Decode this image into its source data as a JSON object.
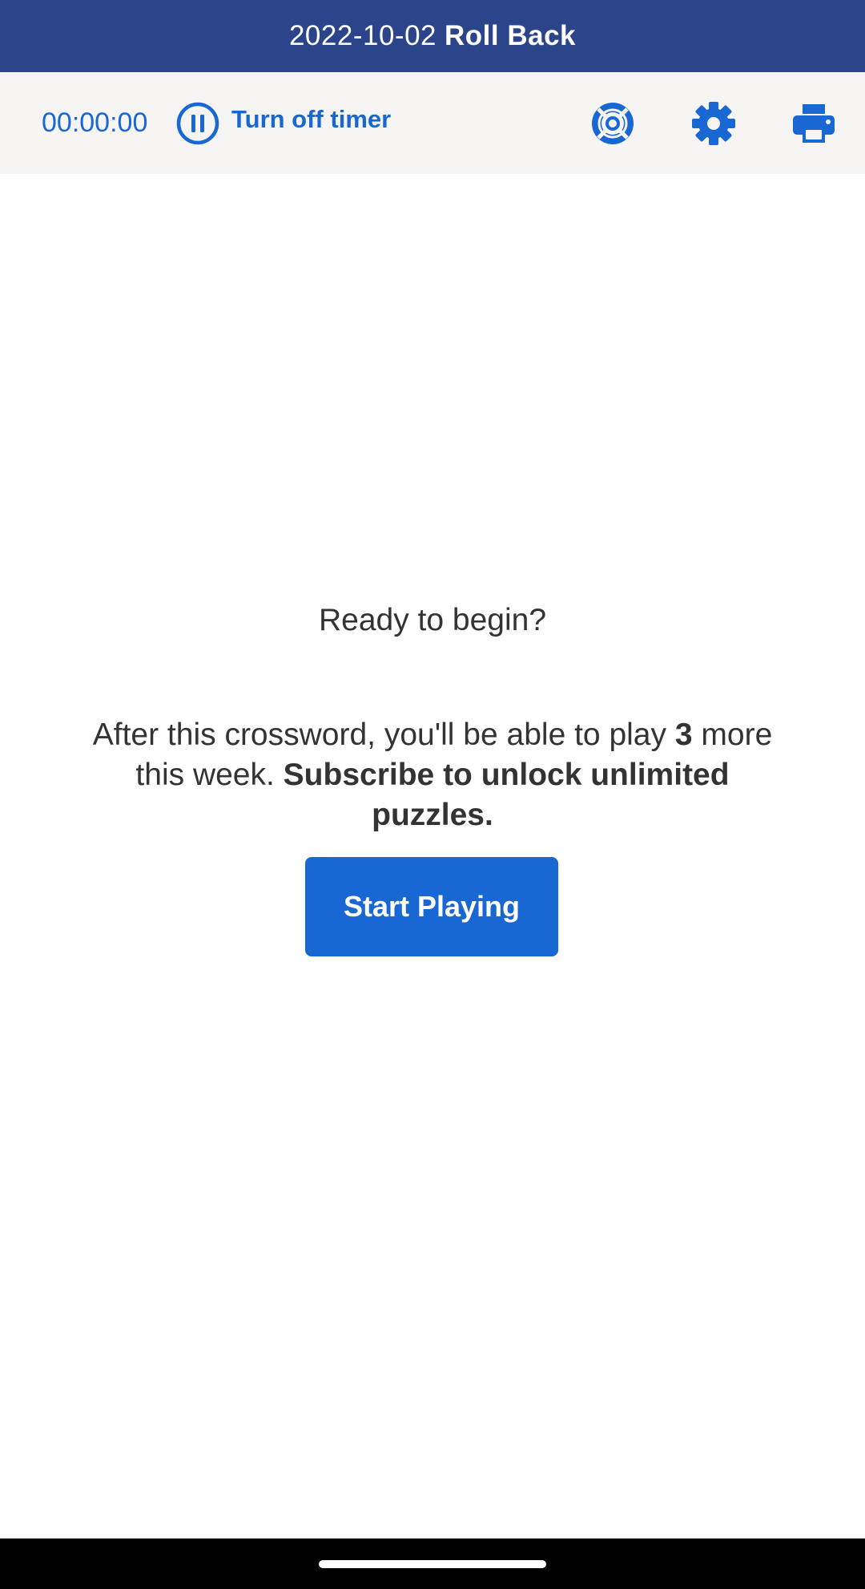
{
  "title_bar": {
    "date": "2022-10-02",
    "name": "Roll Back"
  },
  "toolbar": {
    "timer_value": "00:00:00",
    "timer_toggle_label": "Turn off timer",
    "icons": {
      "pause": "pause-circle-icon",
      "help": "lifebuoy-help-icon",
      "settings": "gear-icon",
      "print": "printer-icon"
    }
  },
  "main": {
    "ready_prompt": "Ready to begin?",
    "info_part1": "After this crossword, you'll be able to play",
    "remaining_count": "3",
    "info_part2": "more this week.",
    "subscribe_text": "Subscribe to unlock unlimited puzzles.",
    "start_button_label": "Start Playing"
  },
  "colors": {
    "title_bar_bg": "#2c4489",
    "accent": "#1967d2",
    "toolbar_bg": "#f6f5f3",
    "text": "#333333"
  }
}
